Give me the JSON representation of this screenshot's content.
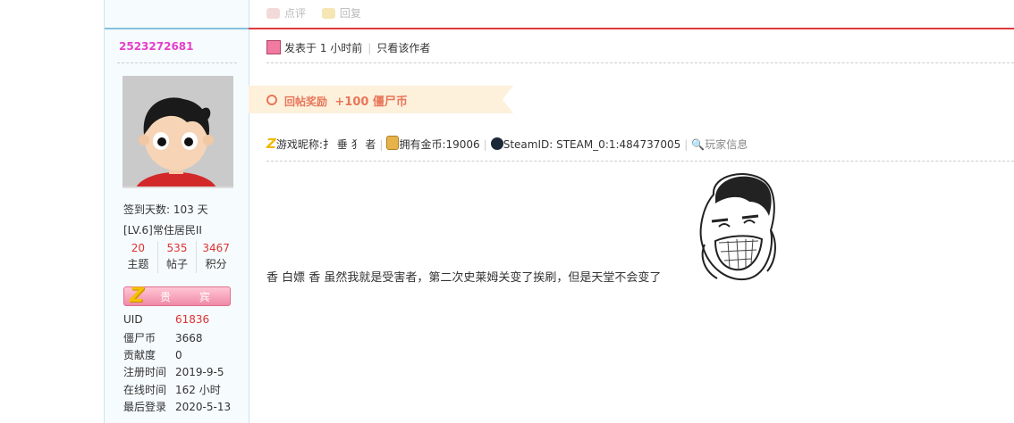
{
  "sidebar": {
    "username": "2523272681",
    "checkin_days": "签到天数: 103 天",
    "level": "[LV.6]常住居民II",
    "stats": [
      {
        "num": "20",
        "label": "主题"
      },
      {
        "num": "535",
        "label": "帖子"
      },
      {
        "num": "3467",
        "label": "积分"
      }
    ],
    "vip_label": "贵 宾",
    "info": [
      {
        "key": "UID",
        "value": "61836"
      },
      {
        "key": "僵尸币",
        "value": "3668"
      },
      {
        "key": "贡献度",
        "value": "0"
      },
      {
        "key": "注册时间",
        "value": "2019-9-5"
      },
      {
        "key": "在线时间",
        "value": "162 小时"
      },
      {
        "key": "最后登录",
        "value": "2020-5-13"
      }
    ]
  },
  "post": {
    "actions": {
      "comment": "点评",
      "reply": "回复"
    },
    "posted": "发表于 1 小时前",
    "author_only": "只看该作者",
    "reward": {
      "label": "回帖奖励",
      "amount": "+100 僵尸币"
    },
    "game": {
      "nickname": "游戏昵称:扌 垂 犭 者",
      "gold": "拥有金币:19006",
      "steam": "SteamID: STEAM_0:1:484737005",
      "player_info": "玩家信息"
    },
    "message": "香 白嫖 香 虽然我就是受害者，第二次史莱姆关变了挨刷，但是天堂不会变了"
  },
  "colors": {
    "accent_red": "#e0393e",
    "username_pink": "#e63ec8",
    "reward_orange": "#e8765a",
    "stat_red": "#d33"
  }
}
